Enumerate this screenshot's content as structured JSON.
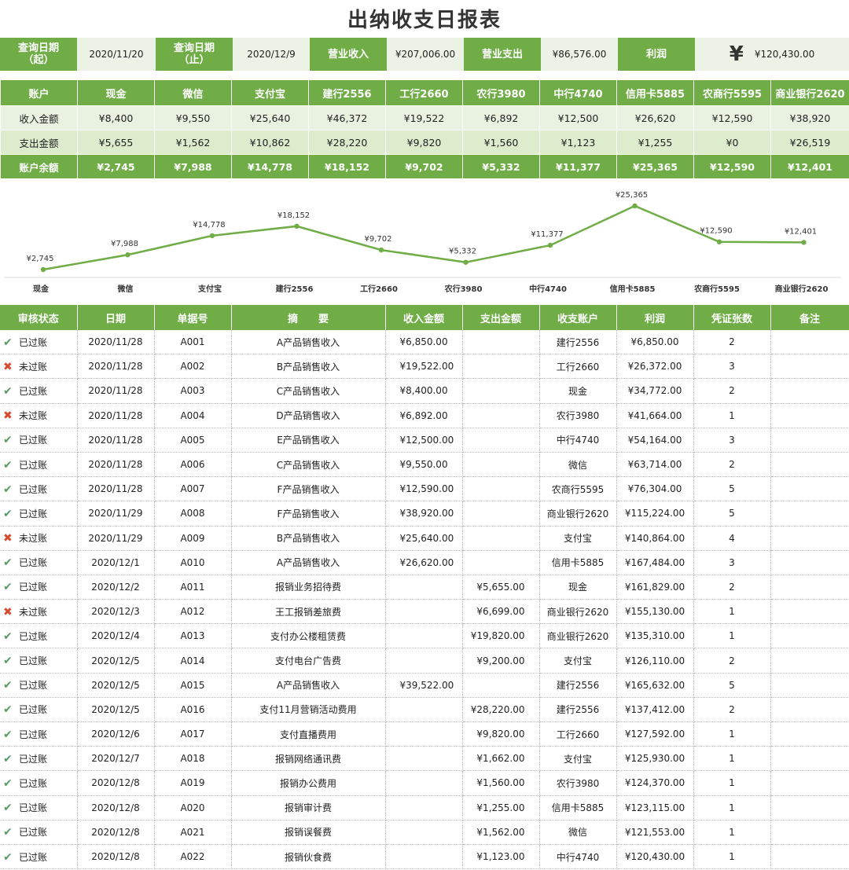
{
  "title": "出纳收支日报表",
  "summary": {
    "start_label": "查询日期\n（起）",
    "start_value": "2020/11/20",
    "end_label": "查询日期\n（止）",
    "end_value": "2020/12/9",
    "income_label": "营业收入",
    "income_value": "¥207,006.00",
    "expense_label": "营业支出",
    "expense_value": "¥86,576.00",
    "profit_label": "利润",
    "profit_symbol": "¥",
    "profit_value": "¥120,430.00"
  },
  "accounts": {
    "header_label": "账户",
    "names": [
      "现金",
      "微信",
      "支付宝",
      "建行2556",
      "工行2660",
      "农行3980",
      "中行4740",
      "信用卡5885",
      "农商行5595",
      "商业银行2620"
    ],
    "income_label": "收入金额",
    "income": [
      "¥8,400",
      "¥9,550",
      "¥25,640",
      "¥46,372",
      "¥19,522",
      "¥6,892",
      "¥12,500",
      "¥26,620",
      "¥12,590",
      "¥38,920"
    ],
    "expense_label": "支出金额",
    "expense": [
      "¥5,655",
      "¥1,562",
      "¥10,862",
      "¥28,220",
      "¥9,820",
      "¥1,560",
      "¥1,123",
      "¥1,255",
      "¥0",
      "¥26,519"
    ],
    "balance_label": "账户余额",
    "balance": [
      "¥2,745",
      "¥7,988",
      "¥14,778",
      "¥18,152",
      "¥9,702",
      "¥5,332",
      "¥11,377",
      "¥25,365",
      "¥12,590",
      "¥12,401"
    ]
  },
  "chart_data": {
    "type": "line",
    "categories": [
      "现金",
      "微信",
      "支付宝",
      "建行2556",
      "工行2660",
      "农行3980",
      "中行4740",
      "信用卡5885",
      "农商行5595",
      "商业银行2620"
    ],
    "values": [
      2745,
      7988,
      14778,
      18152,
      9702,
      5332,
      11377,
      25365,
      12590,
      12401
    ],
    "data_labels": [
      "¥2,745",
      "¥7,988",
      "¥14,778",
      "¥18,152",
      "¥9,702",
      "¥5,332",
      "¥11,377",
      "¥25,365",
      "¥12,590",
      "¥12,401"
    ],
    "color": "#70ad47",
    "grid": false
  },
  "ledger": {
    "headers": [
      "审核状态",
      "日期",
      "单据号",
      "摘　　要",
      "收入金额",
      "支出金额",
      "收支账户",
      "利润",
      "凭证张数",
      "备注"
    ],
    "rows": [
      {
        "ok": true,
        "status": "已过账",
        "date": "2020/11/28",
        "doc": "A001",
        "desc": "A产品销售收入",
        "income": "¥6,850.00",
        "expense": "",
        "account": "建行2556",
        "profit": "¥6,850.00",
        "count": "2",
        "note": ""
      },
      {
        "ok": false,
        "status": "未过账",
        "date": "2020/11/28",
        "doc": "A002",
        "desc": "B产品销售收入",
        "income": "¥19,522.00",
        "expense": "",
        "account": "工行2660",
        "profit": "¥26,372.00",
        "count": "3",
        "note": ""
      },
      {
        "ok": true,
        "status": "已过账",
        "date": "2020/11/28",
        "doc": "A003",
        "desc": "C产品销售收入",
        "income": "¥8,400.00",
        "expense": "",
        "account": "现金",
        "profit": "¥34,772.00",
        "count": "2",
        "note": ""
      },
      {
        "ok": false,
        "status": "未过账",
        "date": "2020/11/28",
        "doc": "A004",
        "desc": "D产品销售收入",
        "income": "¥6,892.00",
        "expense": "",
        "account": "农行3980",
        "profit": "¥41,664.00",
        "count": "1",
        "note": ""
      },
      {
        "ok": true,
        "status": "已过账",
        "date": "2020/11/28",
        "doc": "A005",
        "desc": "E产品销售收入",
        "income": "¥12,500.00",
        "expense": "",
        "account": "中行4740",
        "profit": "¥54,164.00",
        "count": "3",
        "note": ""
      },
      {
        "ok": true,
        "status": "已过账",
        "date": "2020/11/28",
        "doc": "A006",
        "desc": "C产品销售收入",
        "income": "¥9,550.00",
        "expense": "",
        "account": "微信",
        "profit": "¥63,714.00",
        "count": "2",
        "note": ""
      },
      {
        "ok": true,
        "status": "已过账",
        "date": "2020/11/28",
        "doc": "A007",
        "desc": "F产品销售收入",
        "income": "¥12,590.00",
        "expense": "",
        "account": "农商行5595",
        "profit": "¥76,304.00",
        "count": "5",
        "note": ""
      },
      {
        "ok": true,
        "status": "已过账",
        "date": "2020/11/29",
        "doc": "A008",
        "desc": "F产品销售收入",
        "income": "¥38,920.00",
        "expense": "",
        "account": "商业银行2620",
        "profit": "¥115,224.00",
        "count": "5",
        "note": ""
      },
      {
        "ok": false,
        "status": "未过账",
        "date": "2020/11/29",
        "doc": "A009",
        "desc": "B产品销售收入",
        "income": "¥25,640.00",
        "expense": "",
        "account": "支付宝",
        "profit": "¥140,864.00",
        "count": "4",
        "note": ""
      },
      {
        "ok": true,
        "status": "已过账",
        "date": "2020/12/1",
        "doc": "A010",
        "desc": "A产品销售收入",
        "income": "¥26,620.00",
        "expense": "",
        "account": "信用卡5885",
        "profit": "¥167,484.00",
        "count": "3",
        "note": ""
      },
      {
        "ok": true,
        "status": "已过账",
        "date": "2020/12/2",
        "doc": "A011",
        "desc": "报销业务招待费",
        "income": "",
        "expense": "¥5,655.00",
        "account": "现金",
        "profit": "¥161,829.00",
        "count": "2",
        "note": ""
      },
      {
        "ok": false,
        "status": "未过账",
        "date": "2020/12/3",
        "doc": "A012",
        "desc": "王工报销差旅费",
        "income": "",
        "expense": "¥6,699.00",
        "account": "商业银行2620",
        "profit": "¥155,130.00",
        "count": "1",
        "note": ""
      },
      {
        "ok": true,
        "status": "已过账",
        "date": "2020/12/4",
        "doc": "A013",
        "desc": "支付办公楼租赁费",
        "income": "",
        "expense": "¥19,820.00",
        "account": "商业银行2620",
        "profit": "¥135,310.00",
        "count": "1",
        "note": ""
      },
      {
        "ok": true,
        "status": "已过账",
        "date": "2020/12/5",
        "doc": "A014",
        "desc": "支付电台广告费",
        "income": "",
        "expense": "¥9,200.00",
        "account": "支付宝",
        "profit": "¥126,110.00",
        "count": "2",
        "note": ""
      },
      {
        "ok": true,
        "status": "已过账",
        "date": "2020/12/5",
        "doc": "A015",
        "desc": "A产品销售收入",
        "income": "¥39,522.00",
        "expense": "",
        "account": "建行2556",
        "profit": "¥165,632.00",
        "count": "5",
        "note": ""
      },
      {
        "ok": true,
        "status": "已过账",
        "date": "2020/12/5",
        "doc": "A016",
        "desc": "支付11月营销活动费用",
        "income": "",
        "expense": "¥28,220.00",
        "account": "建行2556",
        "profit": "¥137,412.00",
        "count": "2",
        "note": ""
      },
      {
        "ok": true,
        "status": "已过账",
        "date": "2020/12/6",
        "doc": "A017",
        "desc": "支付直播费用",
        "income": "",
        "expense": "¥9,820.00",
        "account": "工行2660",
        "profit": "¥127,592.00",
        "count": "1",
        "note": ""
      },
      {
        "ok": true,
        "status": "已过账",
        "date": "2020/12/7",
        "doc": "A018",
        "desc": "报销网络通讯费",
        "income": "",
        "expense": "¥1,662.00",
        "account": "支付宝",
        "profit": "¥125,930.00",
        "count": "1",
        "note": ""
      },
      {
        "ok": true,
        "status": "已过账",
        "date": "2020/12/8",
        "doc": "A019",
        "desc": "报销办公费用",
        "income": "",
        "expense": "¥1,560.00",
        "account": "农行3980",
        "profit": "¥124,370.00",
        "count": "1",
        "note": ""
      },
      {
        "ok": true,
        "status": "已过账",
        "date": "2020/12/8",
        "doc": "A020",
        "desc": "报销审计费",
        "income": "",
        "expense": "¥1,255.00",
        "account": "信用卡5885",
        "profit": "¥123,115.00",
        "count": "1",
        "note": ""
      },
      {
        "ok": true,
        "status": "已过账",
        "date": "2020/12/8",
        "doc": "A021",
        "desc": "报销误餐费",
        "income": "",
        "expense": "¥1,562.00",
        "account": "微信",
        "profit": "¥121,553.00",
        "count": "1",
        "note": ""
      },
      {
        "ok": true,
        "status": "已过账",
        "date": "2020/12/8",
        "doc": "A022",
        "desc": "报销伙食费",
        "income": "",
        "expense": "¥1,123.00",
        "account": "中行4740",
        "profit": "¥120,430.00",
        "count": "1",
        "note": ""
      }
    ]
  }
}
